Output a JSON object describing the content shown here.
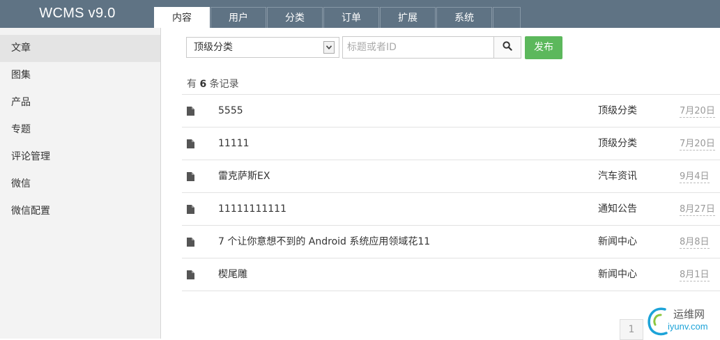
{
  "app": {
    "brand": "WCMS v9.0"
  },
  "tabs": [
    {
      "label": "内容",
      "active": true
    },
    {
      "label": "用户"
    },
    {
      "label": "分类"
    },
    {
      "label": "订单"
    },
    {
      "label": "扩展"
    },
    {
      "label": "系统"
    },
    {
      "label": ""
    }
  ],
  "sidebar": {
    "items": [
      {
        "label": "文章",
        "active": true
      },
      {
        "label": "图集"
      },
      {
        "label": "产品"
      },
      {
        "label": "专题"
      },
      {
        "label": "评论管理"
      },
      {
        "label": "微信"
      },
      {
        "label": "微信配置"
      }
    ]
  },
  "filter": {
    "category_select": "顶级分类",
    "search_placeholder": "标题或者ID",
    "search_value": "",
    "search_icon": "search-icon",
    "publish_label": "发布"
  },
  "count": {
    "prefix": "有",
    "number": "6",
    "suffix": "条记录"
  },
  "articles": [
    {
      "title": "5555",
      "category": "顶级分类",
      "date": "7月20日"
    },
    {
      "title": "11111",
      "category": "顶级分类",
      "date": "7月20日"
    },
    {
      "title": "雷克萨斯EX",
      "category": "汽车资讯",
      "date": "9月4日"
    },
    {
      "title": "11111111111",
      "category": "通知公告",
      "date": "8月27日"
    },
    {
      "title": "7 个让你意想不到的 Android 系统应用领域花11",
      "category": "新闻中心",
      "date": "8月8日"
    },
    {
      "title": "楔尾雕",
      "category": "新闻中心",
      "date": "8月1日"
    }
  ],
  "pagination": {
    "current": "1"
  },
  "watermark": {
    "cn": "运维网",
    "en": "iyunv.com"
  },
  "colors": {
    "topbar": "#5f7384",
    "publish": "#5cb85c",
    "sidebar": "#f3f3f3"
  }
}
